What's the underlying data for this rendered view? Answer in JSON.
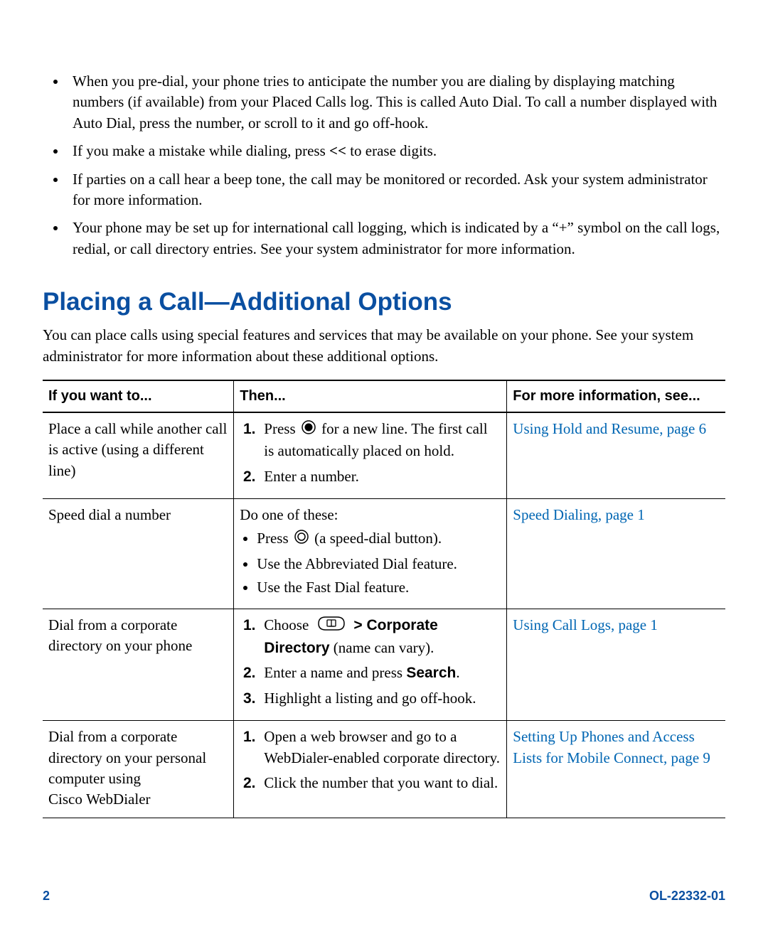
{
  "bullets": {
    "b1_a": "When you pre-dial, your phone tries to anticipate the number you are dialing by displaying matching numbers (if available) from your Placed Calls log. This is called Auto Dial. To call a number displayed with Auto Dial, press the number, or scroll to it and go off-hook.",
    "b2_a": "If you make a mistake while dialing, press ",
    "b2_key": "<<",
    "b2_b": " to erase digits.",
    "b3_a": "If parties on a call hear a beep tone, the call may be monitored or recorded. Ask your system administrator for more information.",
    "b4_a": "Your phone may be set up for international call logging, which is indicated by a “+” symbol on the call logs, redial, or call directory entries. See your system administrator for more information."
  },
  "heading": "Placing a Call—Additional Options",
  "intro": "You can place calls using special features and services that may be available on your phone. See your system administrator for more information about these additional options.",
  "table": {
    "headers": {
      "h1": "If you want to...",
      "h2": "Then...",
      "h3": "For more information, see..."
    },
    "row1": {
      "col1": "Place a call while another call is active (using a different line)",
      "s1a": "Press ",
      "s1b": " for a new line. The first call is automatically placed on hold.",
      "s2": "Enter a number.",
      "link": "Using Hold and Resume, page 6"
    },
    "row2": {
      "col1": "Speed dial a number",
      "lead": "Do one of these:",
      "i1a": "Press ",
      "i1b": " (a speed-dial button).",
      "i2": "Use the Abbreviated Dial feature.",
      "i3": "Use the Fast Dial feature.",
      "link": "Speed Dialing, page 1"
    },
    "row3": {
      "col1": "Dial from a corporate directory on your phone",
      "s1a": "Choose ",
      "s1b_bold": " > Corporate Directory",
      "s1c": " (name can vary).",
      "s2a": "Enter a name and press ",
      "s2b_bold": "Search",
      "s2c": ".",
      "s3": "Highlight a listing and go off-hook.",
      "link": "Using Call Logs, page 1"
    },
    "row4": {
      "col1": "Dial from a corporate directory on your personal computer using Cisco WebDialer",
      "s1": "Open a web browser and go to a WebDialer-enabled corporate directory.",
      "s2": "Click the number that you want to dial.",
      "link": "Setting Up Phones and Access Lists for Mobile Connect, page 9"
    }
  },
  "footer": {
    "page": "2",
    "doc": "OL-22332-01"
  }
}
